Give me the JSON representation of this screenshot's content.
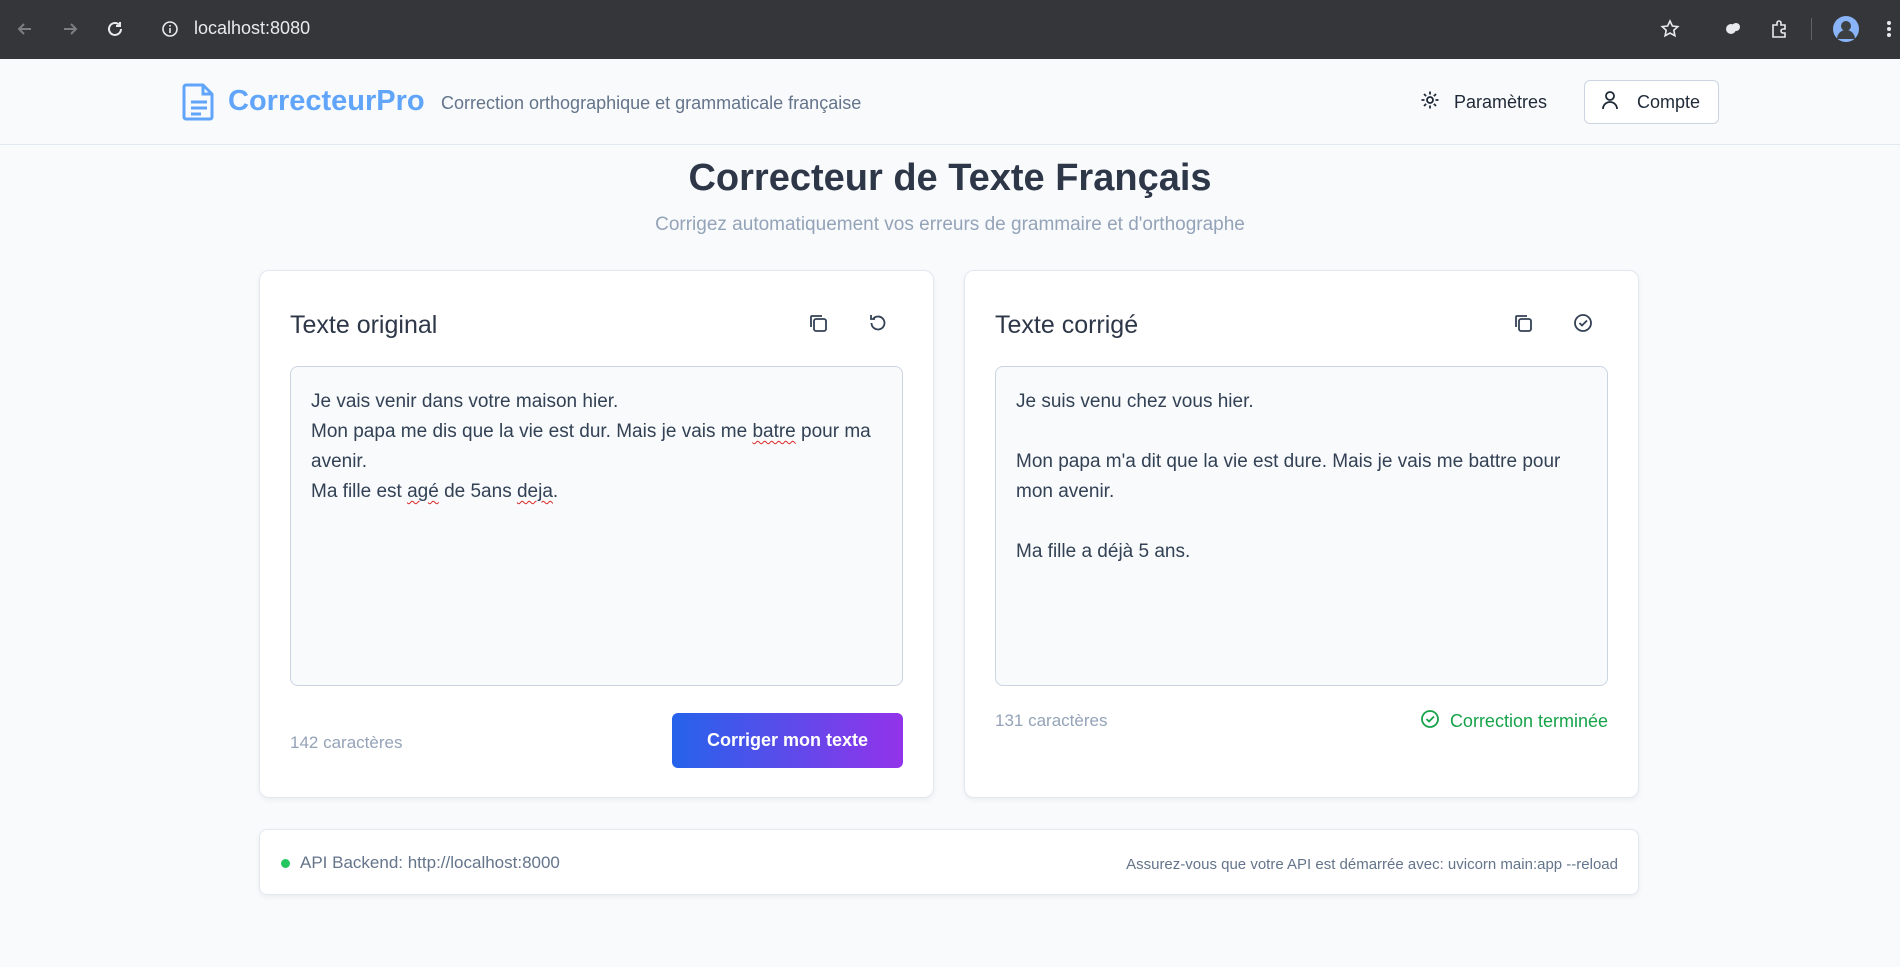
{
  "browser": {
    "url": "localhost:8080"
  },
  "header": {
    "brand": "CorrecteurPro",
    "tagline": "Correction orthographique et grammaticale française",
    "settings_label": "Paramètres",
    "account_label": "Compte"
  },
  "main": {
    "title": "Correcteur de Texte Français",
    "subtitle": "Corrigez automatiquement vos erreurs de grammaire et d'orthographe"
  },
  "original": {
    "title": "Texte original",
    "lines": [
      {
        "pre": "Je vais venir dans votre maison hier.",
        "err": "",
        "post": ""
      },
      {
        "pre": "Mon papa me dis que la vie est dur. Mais je vais me ",
        "err": "batre",
        "post": " pour ma avenir."
      },
      {
        "pre": "Ma fille est ",
        "err": "agé",
        "post": " de 5ans "
      },
      {
        "pre": "",
        "err": "deja",
        "post": "."
      }
    ],
    "char_count": "142 caractères",
    "button_label": "Corriger mon texte"
  },
  "corrected": {
    "title": "Texte corrigé",
    "text": "Je suis venu chez vous hier.\n\nMon papa m'a dit que la vie est dure. Mais je vais me battre pour mon avenir.\n\nMa fille a déjà 5 ans.",
    "char_count": "131 caractères",
    "status": "Correction terminée"
  },
  "footer": {
    "api_label": "API Backend: http://localhost:8000",
    "hint": "Assurez-vous que votre API est démarrée avec: uvicorn main:app --reload"
  },
  "colors": {
    "brand": "#60a5fa",
    "success": "#16a34a",
    "button_gradient_start": "#2563eb",
    "button_gradient_end": "#9333ea",
    "error_squiggle": "#dc2626"
  }
}
